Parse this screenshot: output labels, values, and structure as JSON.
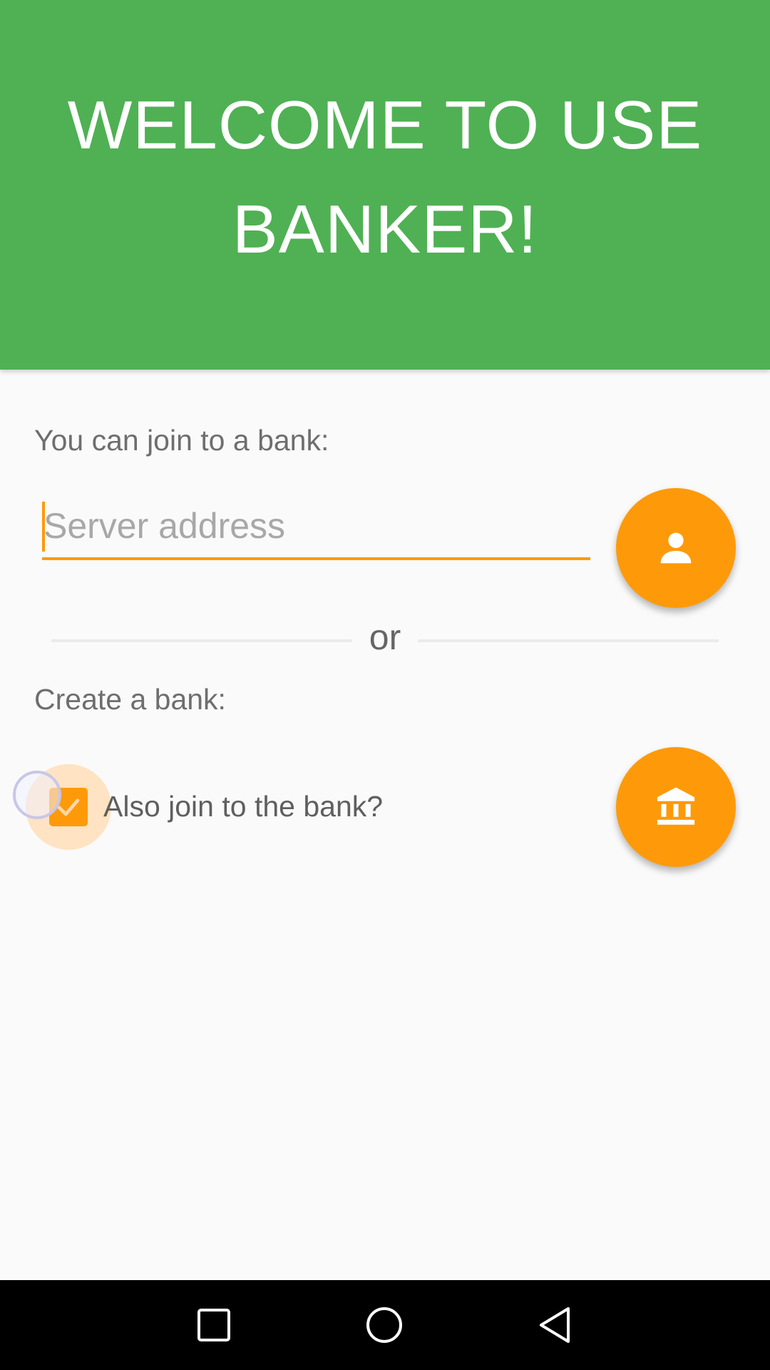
{
  "header": {
    "title": "WELCOME TO USE BANKER!"
  },
  "join": {
    "label": "You can join to a bank:",
    "server_input": {
      "placeholder": "Server address",
      "value": ""
    },
    "button_icon": "person-icon"
  },
  "divider": {
    "text": "or"
  },
  "create": {
    "label": "Create a bank:",
    "also_join_checkbox": {
      "label": "Also join to the bank?",
      "checked": true
    },
    "button_icon": "bank-icon"
  },
  "navbar": {
    "recent_icon": "square-icon",
    "home_icon": "circle-icon",
    "back_icon": "triangle-back-icon"
  },
  "colors": {
    "header_green": "#4fb153",
    "accent_orange": "#fe9a0a",
    "background": "#fafafa"
  }
}
